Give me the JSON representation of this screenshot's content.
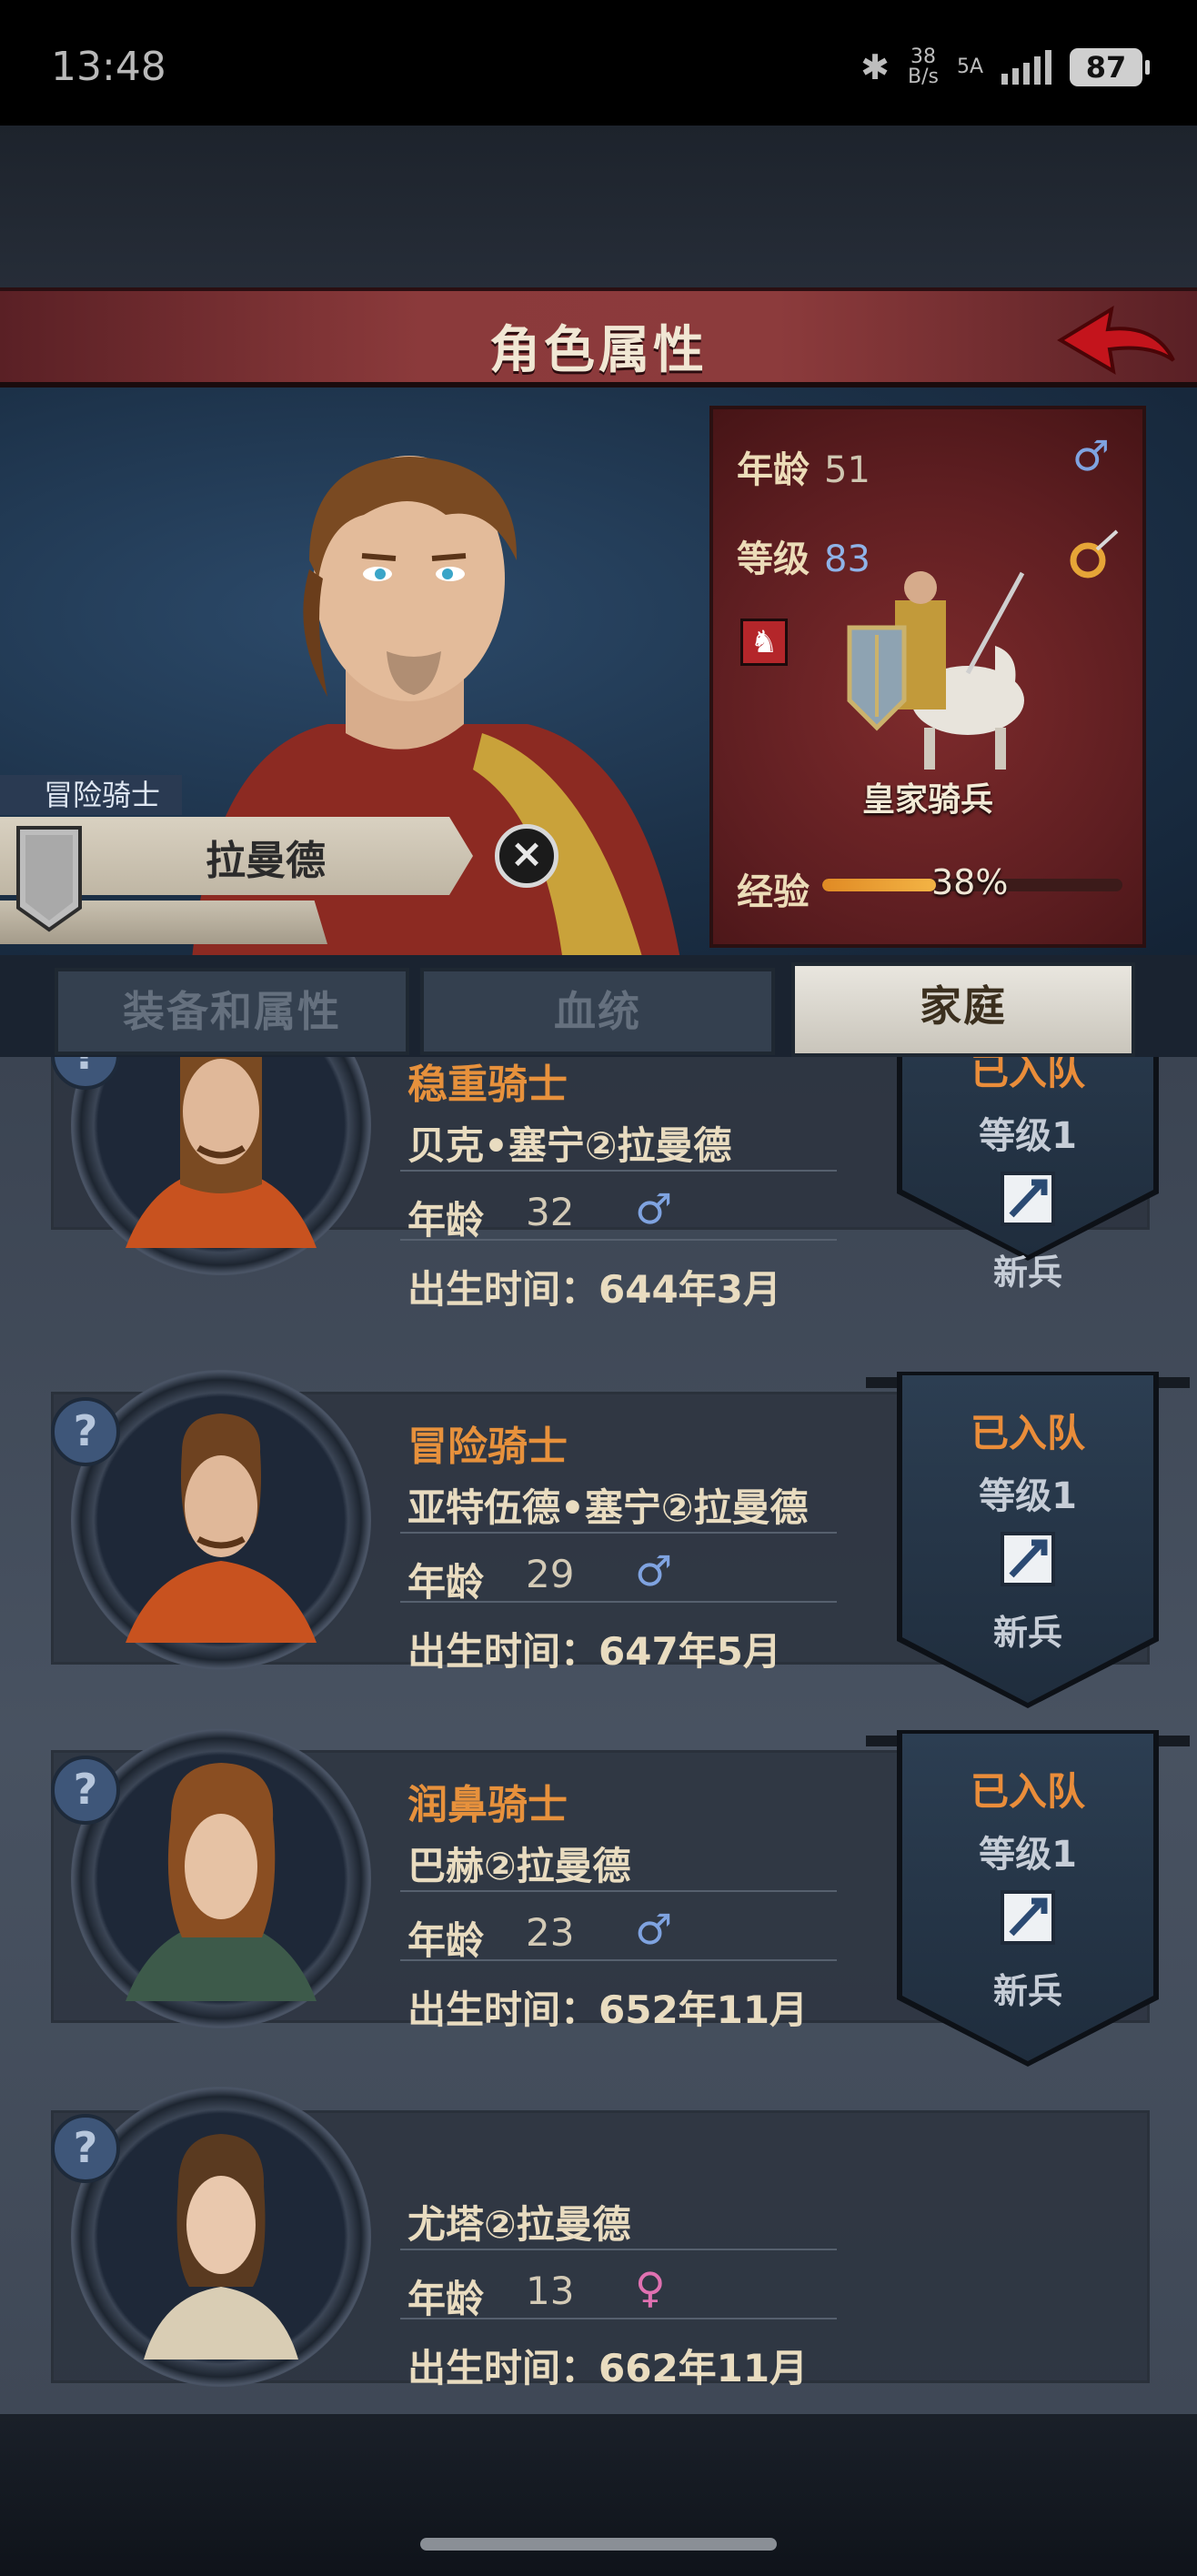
{
  "status_bar": {
    "time": "13:48",
    "bluetooth": "✱",
    "net_speed_top": "38",
    "net_speed_bottom": "B/s",
    "network": "5A",
    "battery": "87"
  },
  "header": {
    "title": "角色属性"
  },
  "character": {
    "class": "冒险骑士",
    "name": "拉曼德"
  },
  "stats": {
    "age_label": "年龄",
    "age": "51",
    "level_label": "等级",
    "level": "83",
    "gender_symbol": "♂",
    "unit_name": "皇家骑兵",
    "exp_label": "经验",
    "exp_percent_text": "38%",
    "exp_fraction": 0.38
  },
  "tabs": [
    {
      "label": "装备和属性",
      "active": false
    },
    {
      "label": "血统",
      "active": false
    },
    {
      "label": "家庭",
      "active": true
    }
  ],
  "family": [
    {
      "class": "稳重骑士",
      "name": "贝克•塞宁②拉曼德",
      "age_label": "年龄",
      "age": "32",
      "gender": "♂",
      "birth": "出生时间：644年3月",
      "status": "已入队",
      "level": "等级1",
      "unit": "新兵",
      "has_pennant": true
    },
    {
      "class": "冒险骑士",
      "name": "亚特伍德•塞宁②拉曼德",
      "age_label": "年龄",
      "age": "29",
      "gender": "♂",
      "birth": "出生时间：647年5月",
      "status": "已入队",
      "level": "等级1",
      "unit": "新兵",
      "has_pennant": true
    },
    {
      "class": "润鼻骑士",
      "name": "巴赫②拉曼德",
      "age_label": "年龄",
      "age": "23",
      "gender": "♂",
      "birth": "出生时间：652年11月",
      "status": "已入队",
      "level": "等级1",
      "unit": "新兵",
      "has_pennant": true
    },
    {
      "class": "",
      "name": "尤塔②拉曼德",
      "age_label": "年龄",
      "age": "13",
      "gender": "♀",
      "birth": "出生时间：662年11月",
      "has_pennant": false
    }
  ],
  "icons": {
    "question": "?",
    "close": "×",
    "horse": "♞"
  },
  "colors": {
    "title_bar": "#8b3a3b",
    "accent_orange": "#e7913c",
    "male_blue": "#7fa3e0",
    "female_pink": "#e071b1"
  }
}
